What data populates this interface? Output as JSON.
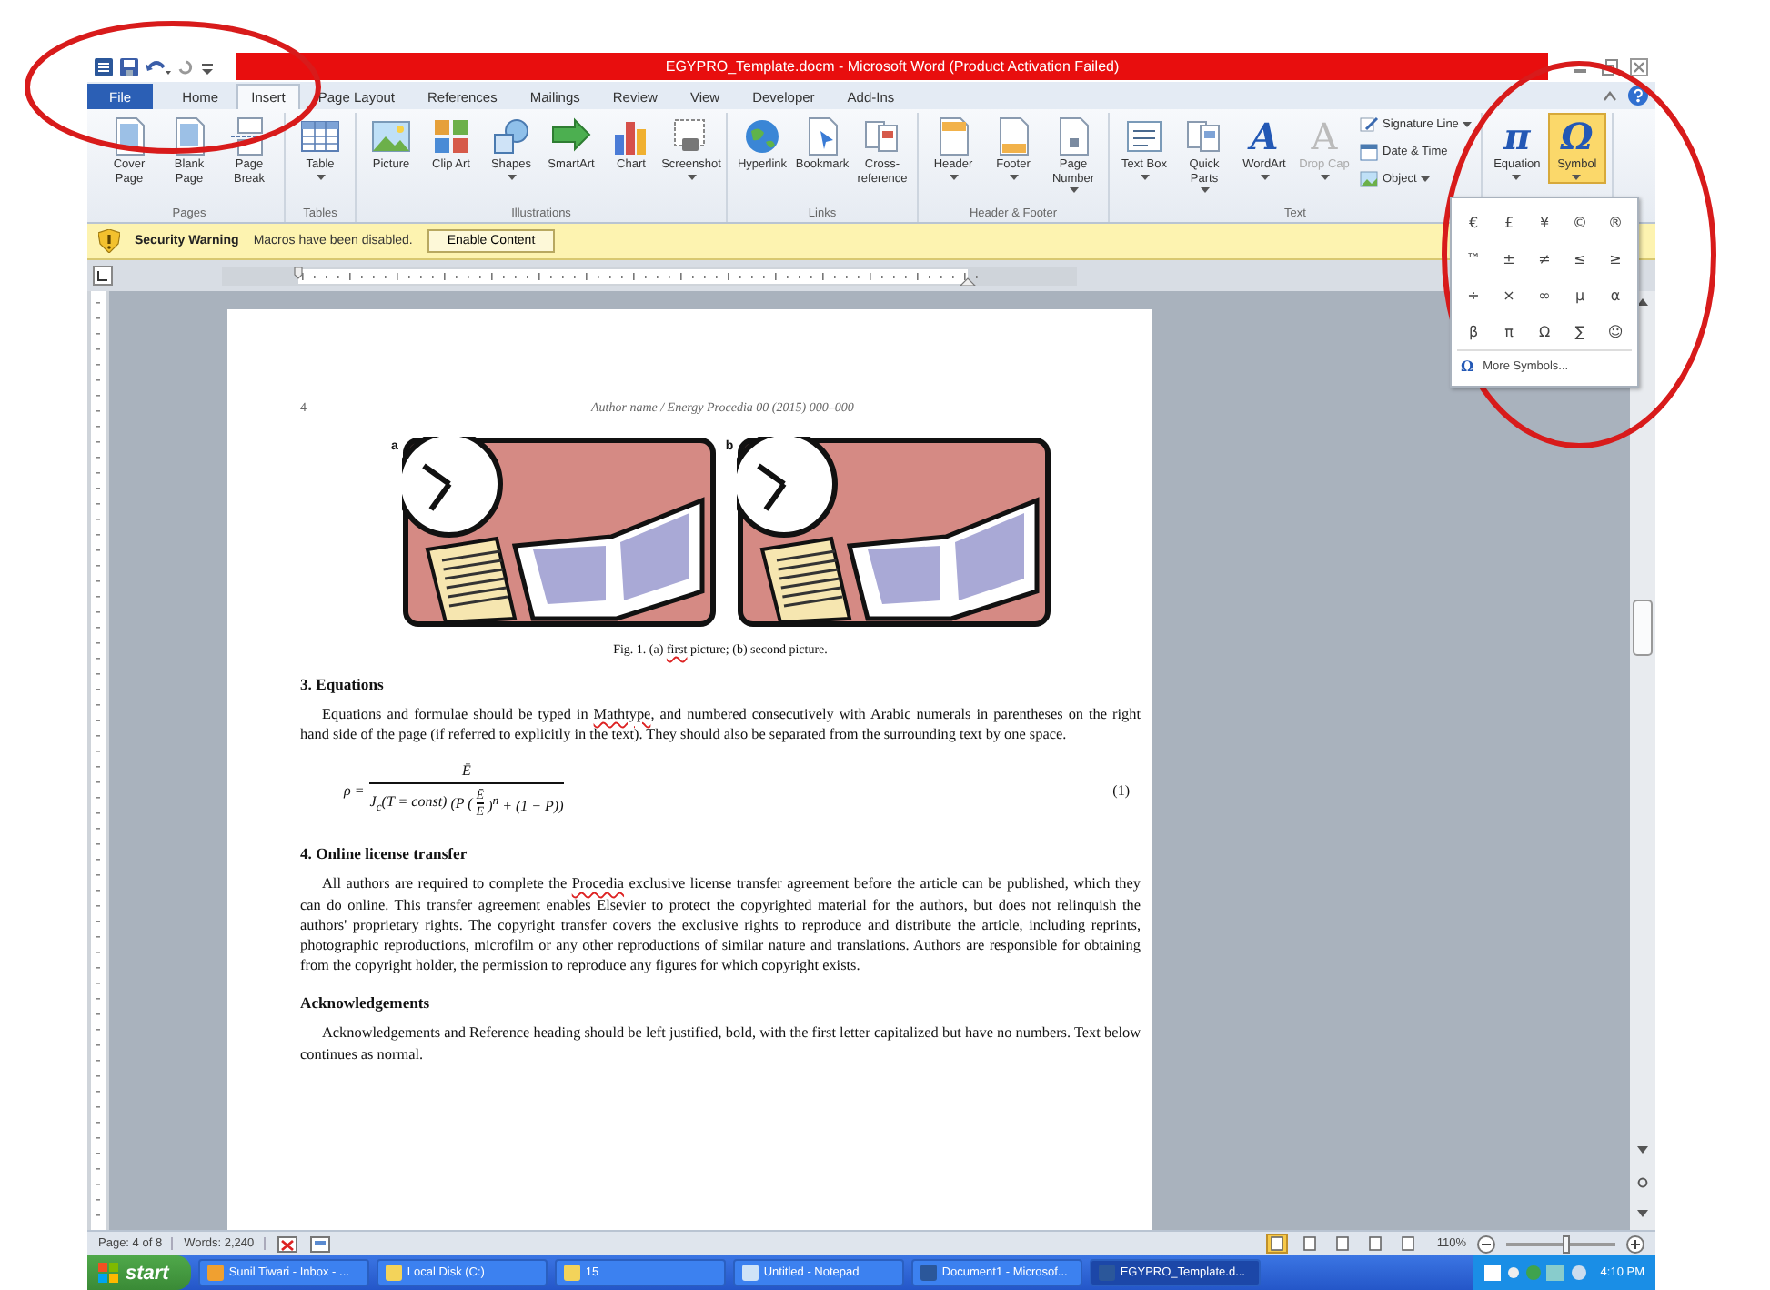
{
  "window": {
    "title": "EGYPRO_Template.docm - Microsoft Word (Product Activation Failed)"
  },
  "ribbon_tabs": [
    {
      "label": "File",
      "kind": "file",
      "selected": false
    },
    {
      "label": "Home",
      "kind": "tab",
      "selected": false
    },
    {
      "label": "Insert",
      "kind": "tab",
      "selected": true
    },
    {
      "label": "Page Layout",
      "kind": "tab",
      "selected": false
    },
    {
      "label": "References",
      "kind": "tab",
      "selected": false
    },
    {
      "label": "Mailings",
      "kind": "tab",
      "selected": false
    },
    {
      "label": "Review",
      "kind": "tab",
      "selected": false
    },
    {
      "label": "View",
      "kind": "tab",
      "selected": false
    },
    {
      "label": "Developer",
      "kind": "tab",
      "selected": false
    },
    {
      "label": "Add-Ins",
      "kind": "tab",
      "selected": false
    }
  ],
  "ribbon_groups": [
    {
      "label": "Pages",
      "buttons": [
        {
          "label": "Cover Page",
          "kind": "large",
          "dropdown": false,
          "disabled": false,
          "selected": false
        },
        {
          "label": "Blank Page",
          "kind": "large",
          "dropdown": false,
          "disabled": false,
          "selected": false
        },
        {
          "label": "Page Break",
          "kind": "large",
          "dropdown": false,
          "disabled": false,
          "selected": false
        }
      ]
    },
    {
      "label": "Tables",
      "buttons": [
        {
          "label": "Table",
          "kind": "large",
          "dropdown": true,
          "disabled": false,
          "selected": false
        }
      ]
    },
    {
      "label": "Illustrations",
      "buttons": [
        {
          "label": "Picture",
          "kind": "large",
          "dropdown": false,
          "disabled": false,
          "selected": false
        },
        {
          "label": "Clip Art",
          "kind": "large",
          "dropdown": false,
          "disabled": false,
          "selected": false
        },
        {
          "label": "Shapes",
          "kind": "large",
          "dropdown": true,
          "disabled": false,
          "selected": false
        },
        {
          "label": "SmartArt",
          "kind": "large",
          "dropdown": false,
          "disabled": false,
          "selected": false
        },
        {
          "label": "Chart",
          "kind": "large",
          "dropdown": false,
          "disabled": false,
          "selected": false
        },
        {
          "label": "Screenshot",
          "kind": "large",
          "dropdown": true,
          "disabled": false,
          "selected": false
        }
      ]
    },
    {
      "label": "Links",
      "buttons": [
        {
          "label": "Hyperlink",
          "kind": "large",
          "dropdown": false,
          "disabled": false,
          "selected": false
        },
        {
          "label": "Bookmark",
          "kind": "large",
          "dropdown": false,
          "disabled": false,
          "selected": false
        },
        {
          "label": "Cross-reference",
          "kind": "large",
          "dropdown": false,
          "disabled": false,
          "selected": false
        }
      ]
    },
    {
      "label": "Header & Footer",
      "buttons": [
        {
          "label": "Header",
          "kind": "large",
          "dropdown": true,
          "disabled": false,
          "selected": false
        },
        {
          "label": "Footer",
          "kind": "large",
          "dropdown": true,
          "disabled": false,
          "selected": false
        },
        {
          "label": "Page Number",
          "kind": "large",
          "dropdown": true,
          "disabled": false,
          "selected": false
        }
      ]
    },
    {
      "label": "Text",
      "buttons": [
        {
          "label": "Text Box",
          "kind": "large",
          "dropdown": true,
          "disabled": false,
          "selected": false
        },
        {
          "label": "Quick Parts",
          "kind": "large",
          "dropdown": true,
          "disabled": false,
          "selected": false
        },
        {
          "label": "WordArt",
          "kind": "glyph",
          "glyph": "A",
          "dropdown": true,
          "disabled": false,
          "selected": false
        },
        {
          "label": "Drop Cap",
          "kind": "glyph",
          "glyph": "A",
          "dropdown": true,
          "disabled": true,
          "selected": false
        },
        {
          "label": "Signature Line",
          "kind": "small",
          "dropdown": true,
          "disabled": false,
          "selected": false
        },
        {
          "label": "Date & Time",
          "kind": "small",
          "dropdown": false,
          "disabled": false,
          "selected": false
        },
        {
          "label": "Object",
          "kind": "small",
          "dropdown": true,
          "disabled": false,
          "selected": false
        }
      ]
    },
    {
      "buttons": [
        {
          "label": "Equation",
          "kind": "glyph",
          "glyph": "π",
          "dropdown": true,
          "disabled": false,
          "selected": false
        },
        {
          "label": "Symbol",
          "kind": "glyph",
          "glyph": "Ω",
          "dropdown": true,
          "disabled": false,
          "selected": true
        }
      ]
    }
  ],
  "symbol_menu": {
    "symbols": [
      "€",
      "£",
      "¥",
      "©",
      "®",
      "™",
      "±",
      "≠",
      "≤",
      "≥",
      "÷",
      "×",
      "∞",
      "µ",
      "α",
      "β",
      "π",
      "Ω",
      "∑",
      "☺"
    ],
    "more": {
      "icon_glyph": "Ω",
      "label": "More Symbols..."
    }
  },
  "message_bar": {
    "title": "Security Warning",
    "message": "Macros have been disabled.",
    "button": "Enable Content"
  },
  "document": {
    "page_number": "4",
    "running_head": "Author name / Energy Procedia 00 (2015) 000–000",
    "figures": [
      {
        "label": "a",
        "kind": "picture"
      },
      {
        "label": "b",
        "kind": "picture"
      }
    ],
    "caption": [
      {
        "text": "Fig. 1. (a) ",
        "misspelled": false
      },
      {
        "text": "first",
        "misspelled": true
      },
      {
        "text": " picture; (b) second picture.",
        "misspelled": false
      }
    ],
    "blocks": [
      {
        "kind": "heading",
        "text": "3. Equations"
      },
      {
        "kind": "paragraph",
        "segments": [
          {
            "text": "Equations and formulae should be typed in ",
            "misspelled": false
          },
          {
            "text": "Mathtype",
            "misspelled": true
          },
          {
            "text": ", and numbered consecutively with Arabic numerals in parentheses on the right hand side of the page (if referred to explicitly in the text). They should also be separated from the surrounding text by one space.",
            "misspelled": false
          }
        ]
      },
      {
        "kind": "equation",
        "lhs": "ρ =",
        "numerator": "Ē",
        "prefix": "J$_{c}$(T = const)",
        "before": "(P (",
        "inner_numerator": "Ē",
        "inner_denominator": "E",
        "after": ")$^{n}$ + (1 − P))",
        "number": "(1)"
      },
      {
        "kind": "heading",
        "text": "4. Online license transfer"
      },
      {
        "kind": "paragraph",
        "segments": [
          {
            "text": "All authors are required to complete the ",
            "misspelled": false
          },
          {
            "text": "Procedia",
            "misspelled": true
          },
          {
            "text": " exclusive license transfer agreement before the article can be published, which they can do online. This transfer agreement enables Elsevier to protect the copyrighted material for the authors, but does not relinquish the authors' proprietary rights. The copyright transfer covers the exclusive rights to reproduce and distribute the article, including reprints, photographic reproductions, microfilm or any other reproductions of similar nature and translations. Authors are responsible for obtaining from the copyright holder, the permission to reproduce any figures for which copyright exists.",
            "misspelled": false
          }
        ]
      },
      {
        "kind": "heading",
        "text": "Acknowledgements"
      },
      {
        "kind": "paragraph",
        "segments": [
          {
            "text": "Acknowledgements and Reference heading should be left justified, bold, with the first letter capitalized but have no numbers. Text below continues as normal.",
            "misspelled": false
          }
        ]
      }
    ]
  },
  "status_bar": {
    "page": "Page: 4 of 8",
    "words": "Words: 2,240",
    "views": [
      {
        "selected": true
      },
      {
        "selected": false
      },
      {
        "selected": false
      },
      {
        "selected": false
      },
      {
        "selected": false
      }
    ],
    "zoom": "110%",
    "level": 0.55
  },
  "taskbar": {
    "start": "start",
    "tasks": [
      {
        "label": "Sunil Tiwari - Inbox - ...",
        "selected": false
      },
      {
        "label": "Local Disk (C:)",
        "selected": false
      },
      {
        "label": "15",
        "selected": false
      },
      {
        "label": "Untitled - Notepad",
        "selected": false
      },
      {
        "label": "Document1 - Microsof...",
        "selected": false
      },
      {
        "label": "EGYPRO_Template.d...",
        "selected": true
      }
    ],
    "time": "4:10 PM"
  },
  "annotations": [
    {
      "kind": "circle"
    },
    {
      "kind": "circle"
    }
  ]
}
